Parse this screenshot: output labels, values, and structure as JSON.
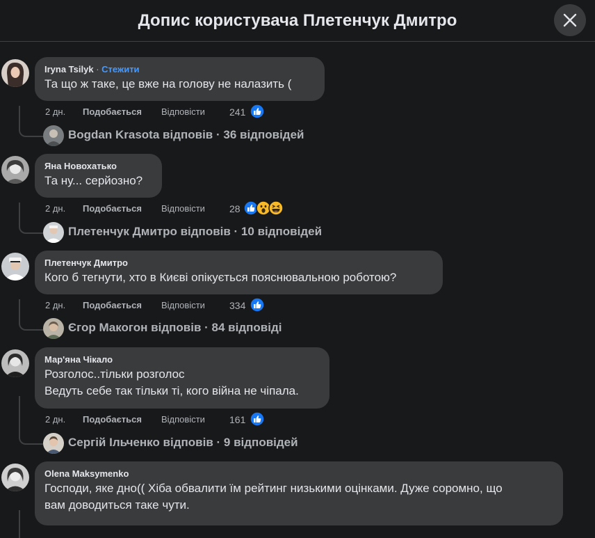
{
  "header": {
    "title": "Допис користувача Плетенчук Дмитро",
    "close_label": "Закрити"
  },
  "comments": [
    {
      "author": "Iryna Tsilyk",
      "follow": "Стежити",
      "lines": [
        "Та що ж таке, це вже на голову не налазить ("
      ],
      "time": "2 дн.",
      "like": "Подобається",
      "reply": "Відповісти",
      "reactions_count": "241",
      "replies_text": "Bogdan Krasota відповів · 36 відповідей"
    },
    {
      "author": "Яна Новохатько",
      "lines": [
        "Та ну... серйозно?"
      ],
      "time": "2 дн.",
      "like": "Подобається",
      "reply": "Відповісти",
      "reactions_count": "28",
      "replies_text": "Плетенчук Дмитро відповів · 10 відповідей"
    },
    {
      "author": "Плетенчук Дмитро",
      "lines": [
        "Кого б тегнути, хто в Києві опікується пояснювальною роботою?"
      ],
      "time": "2 дн.",
      "like": "Подобається",
      "reply": "Відповісти",
      "reactions_count": "334",
      "replies_text": "Єгор Макогон відповів · 84 відповіді"
    },
    {
      "author": "Мар'яна Чікало",
      "lines": [
        "Розголос..тільки розголос",
        "Ведуть себе так тільки ті, кого війна не чіпала."
      ],
      "time": "2 дн.",
      "like": "Подобається",
      "reply": "Відповісти",
      "reactions_count": "161",
      "replies_text": "Сергій Ільченко відповів · 9 відповідей"
    },
    {
      "author": "Olena Maksymenko",
      "lines": [
        "Господи, яке дно(( Хіба обвалити їм рейтинг низькими оцінками. Дуже соромно, що",
        "вам доводиться таке чути."
      ]
    }
  ],
  "colors": {
    "background": "#18191a",
    "bubble": "#3a3b3c",
    "like_blue": "#1877f2",
    "follow_blue": "#4599ff"
  },
  "icons": {
    "close": "close-icon",
    "like": "like-icon",
    "wow": "wow-icon",
    "haha": "haha-icon"
  }
}
